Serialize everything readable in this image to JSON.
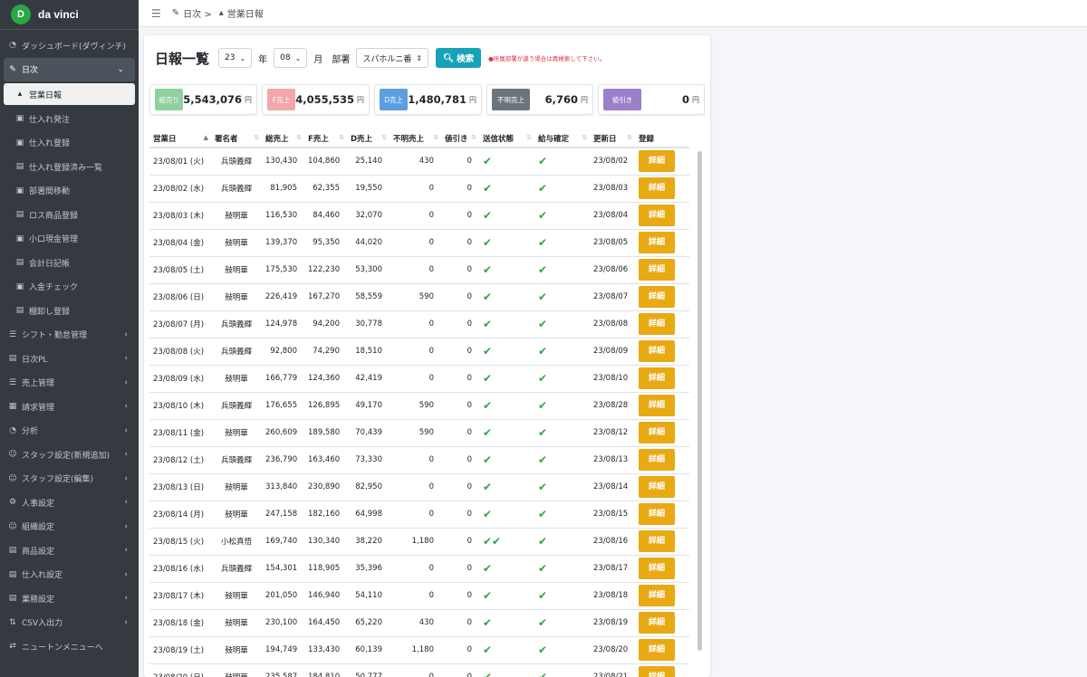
{
  "brand": {
    "logo_letter": "D",
    "name": "da vinci"
  },
  "sidebar": {
    "items": [
      {
        "icon": "◔",
        "icon_name": "dashboard-icon",
        "label": "ダッシュボード(ダヴィンチ)"
      },
      {
        "icon": "✎",
        "icon_name": "edit-icon",
        "label": "日次",
        "arrow": "⌄"
      },
      {
        "icon": "☰",
        "icon_name": "list-icon",
        "label": "シフト・勤怠管理",
        "arrow": "‹"
      },
      {
        "icon": "▤",
        "icon_name": "calendar-icon",
        "label": "日次PL",
        "arrow": "‹"
      },
      {
        "icon": "☰",
        "icon_name": "list-icon",
        "label": "売上管理",
        "arrow": "‹"
      },
      {
        "icon": "▦",
        "icon_name": "invoice-icon",
        "label": "請求管理",
        "arrow": "‹"
      },
      {
        "icon": "◔",
        "icon_name": "chart-pie-icon",
        "label": "分析",
        "arrow": "‹"
      },
      {
        "icon": "☺",
        "icon_name": "user-plus-icon",
        "label": "スタッフ設定(新規追加)",
        "arrow": "‹"
      },
      {
        "icon": "☺",
        "icon_name": "user-edit-icon",
        "label": "スタッフ設定(編集)",
        "arrow": "‹"
      },
      {
        "icon": "⚙",
        "icon_name": "gear-icon",
        "label": "人事設定",
        "arrow": "‹"
      },
      {
        "icon": "☺",
        "icon_name": "users-icon",
        "label": "組織設定",
        "arrow": "‹"
      },
      {
        "icon": "▤",
        "icon_name": "product-icon",
        "label": "商品設定",
        "arrow": "‹"
      },
      {
        "icon": "▤",
        "icon_name": "truck-icon",
        "label": "仕入れ設定",
        "arrow": "‹"
      },
      {
        "icon": "▤",
        "icon_name": "briefcase-icon",
        "label": "業務設定",
        "arrow": "‹"
      },
      {
        "icon": "⇅",
        "icon_name": "csv-icon",
        "label": "CSV入出力",
        "arrow": "‹"
      },
      {
        "icon": "⇄",
        "icon_name": "switch-icon",
        "label": "ニュートンメニューへ"
      }
    ],
    "sub_items": [
      {
        "icon": "▴",
        "icon_name": "cubes-icon",
        "label": "営業日報"
      },
      {
        "icon": "▣",
        "icon_name": "truck-icon",
        "label": "仕入れ発注"
      },
      {
        "icon": "▣",
        "icon_name": "truck-icon",
        "label": "仕入れ登録"
      },
      {
        "icon": "▤",
        "icon_name": "file-icon",
        "label": "仕入れ登録済み一覧"
      },
      {
        "icon": "▣",
        "icon_name": "transfer-icon",
        "label": "部署間移動"
      },
      {
        "icon": "▤",
        "icon_name": "trash-icon",
        "label": "ロス商品登録"
      },
      {
        "icon": "▣",
        "icon_name": "cash-icon",
        "label": "小口現金管理"
      },
      {
        "icon": "▤",
        "icon_name": "book-icon",
        "label": "会計日記帳"
      },
      {
        "icon": "▣",
        "icon_name": "deposit-icon",
        "label": "入金チェック"
      },
      {
        "icon": "▤",
        "icon_name": "inventory-icon",
        "label": "棚卸し登録"
      }
    ]
  },
  "topbar": {
    "menu_icon": "☰",
    "crumb1": "日次 >",
    "crumb2": "営業日報"
  },
  "header": {
    "title": "日報一覧",
    "year_value": "23",
    "year_label": "年",
    "month_value": "08",
    "month_label": "月",
    "dept_label": "部署",
    "dept_value": "スパホルニ番",
    "search_label": "検索",
    "warning": "●所属部署が違う場合は再検索して下さい。"
  },
  "summary": [
    {
      "badge": "総売り",
      "value": "5,543,076",
      "unit": "円",
      "color": "#8fd19e"
    },
    {
      "badge": "F売上",
      "value": "4,055,535",
      "unit": "円",
      "color": "#f1a7ac"
    },
    {
      "badge": "D売上",
      "value": "1,480,781",
      "unit": "円",
      "color": "#5b9fe0"
    },
    {
      "badge": "不明売上",
      "value": "6,760",
      "unit": "円",
      "color": "#6c757d"
    },
    {
      "badge": "値引き",
      "value": "0",
      "unit": "円",
      "color": "#9b7fc9"
    }
  ],
  "table": {
    "headers": [
      "営業日",
      "署名者",
      "総売上",
      "F売上",
      "D売上",
      "不明売上",
      "値引き",
      "送信状態",
      "給与確定",
      "更新日",
      "登録"
    ],
    "check": "✔",
    "detail_label": "詳細",
    "rows": [
      {
        "date": "23/08/01 (火)",
        "signer": "兵頭義輝",
        "total": "130,430",
        "f": "104,860",
        "d": "25,140",
        "unknown": "430",
        "discount": "0",
        "sent": "✔",
        "pay": "✔",
        "updated": "23/08/02"
      },
      {
        "date": "23/08/02 (水)",
        "signer": "兵頭義輝",
        "total": "81,905",
        "f": "62,355",
        "d": "19,550",
        "unknown": "0",
        "discount": "0",
        "sent": "✔",
        "pay": "✔",
        "updated": "23/08/03"
      },
      {
        "date": "23/08/03 (木)",
        "signer": "鼓明華",
        "total": "116,530",
        "f": "84,460",
        "d": "32,070",
        "unknown": "0",
        "discount": "0",
        "sent": "✔",
        "pay": "✔",
        "updated": "23/08/04"
      },
      {
        "date": "23/08/04 (金)",
        "signer": "鼓明華",
        "total": "139,370",
        "f": "95,350",
        "d": "44,020",
        "unknown": "0",
        "discount": "0",
        "sent": "✔",
        "pay": "✔",
        "updated": "23/08/05"
      },
      {
        "date": "23/08/05 (土)",
        "signer": "鼓明華",
        "total": "175,530",
        "f": "122,230",
        "d": "53,300",
        "unknown": "0",
        "discount": "0",
        "sent": "✔",
        "pay": "✔",
        "updated": "23/08/06"
      },
      {
        "date": "23/08/06 (日)",
        "signer": "鼓明華",
        "total": "226,419",
        "f": "167,270",
        "d": "58,559",
        "unknown": "590",
        "discount": "0",
        "sent": "✔",
        "pay": "✔",
        "updated": "23/08/07"
      },
      {
        "date": "23/08/07 (月)",
        "signer": "兵頭義輝",
        "total": "124,978",
        "f": "94,200",
        "d": "30,778",
        "unknown": "0",
        "discount": "0",
        "sent": "✔",
        "pay": "✔",
        "updated": "23/08/08"
      },
      {
        "date": "23/08/08 (火)",
        "signer": "兵頭義輝",
        "total": "92,800",
        "f": "74,290",
        "d": "18,510",
        "unknown": "0",
        "discount": "0",
        "sent": "✔",
        "pay": "✔",
        "updated": "23/08/09"
      },
      {
        "date": "23/08/09 (水)",
        "signer": "鼓明華",
        "total": "166,779",
        "f": "124,360",
        "d": "42,419",
        "unknown": "0",
        "discount": "0",
        "sent": "✔",
        "pay": "✔",
        "updated": "23/08/10"
      },
      {
        "date": "23/08/10 (木)",
        "signer": "兵頭義輝",
        "total": "176,655",
        "f": "126,895",
        "d": "49,170",
        "unknown": "590",
        "discount": "0",
        "sent": "✔",
        "pay": "✔",
        "updated": "23/08/28"
      },
      {
        "date": "23/08/11 (金)",
        "signer": "鼓明華",
        "total": "260,609",
        "f": "189,580",
        "d": "70,439",
        "unknown": "590",
        "discount": "0",
        "sent": "✔",
        "pay": "✔",
        "updated": "23/08/12"
      },
      {
        "date": "23/08/12 (土)",
        "signer": "兵頭義輝",
        "total": "236,790",
        "f": "163,460",
        "d": "73,330",
        "unknown": "0",
        "discount": "0",
        "sent": "✔",
        "pay": "✔",
        "updated": "23/08/13"
      },
      {
        "date": "23/08/13 (日)",
        "signer": "鼓明華",
        "total": "313,840",
        "f": "230,890",
        "d": "82,950",
        "unknown": "0",
        "discount": "0",
        "sent": "✔",
        "pay": "✔",
        "updated": "23/08/14"
      },
      {
        "date": "23/08/14 (月)",
        "signer": "鼓明華",
        "total": "247,158",
        "f": "182,160",
        "d": "64,998",
        "unknown": "0",
        "discount": "0",
        "sent": "✔",
        "pay": "✔",
        "updated": "23/08/15"
      },
      {
        "date": "23/08/15 (火)",
        "signer": "小松真悟",
        "total": "169,740",
        "f": "130,340",
        "d": "38,220",
        "unknown": "1,180",
        "discount": "0",
        "sent": "✔✔",
        "pay": "✔",
        "updated": "23/08/16"
      },
      {
        "date": "23/08/16 (水)",
        "signer": "兵頭義輝",
        "total": "154,301",
        "f": "118,905",
        "d": "35,396",
        "unknown": "0",
        "discount": "0",
        "sent": "✔",
        "pay": "✔",
        "updated": "23/08/17"
      },
      {
        "date": "23/08/17 (木)",
        "signer": "鼓明華",
        "total": "201,050",
        "f": "146,940",
        "d": "54,110",
        "unknown": "0",
        "discount": "0",
        "sent": "✔",
        "pay": "✔",
        "updated": "23/08/18"
      },
      {
        "date": "23/08/18 (金)",
        "signer": "鼓明華",
        "total": "230,100",
        "f": "164,450",
        "d": "65,220",
        "unknown": "430",
        "discount": "0",
        "sent": "✔",
        "pay": "✔",
        "updated": "23/08/19"
      },
      {
        "date": "23/08/19 (土)",
        "signer": "鼓明華",
        "total": "194,749",
        "f": "133,430",
        "d": "60,139",
        "unknown": "1,180",
        "discount": "0",
        "sent": "✔",
        "pay": "✔",
        "updated": "23/08/20"
      },
      {
        "date": "23/08/20 (日)",
        "signer": "鼓明華",
        "total": "235,587",
        "f": "184,810",
        "d": "50,777",
        "unknown": "0",
        "discount": "0",
        "sent": "✔",
        "pay": "✔",
        "updated": "23/08/21"
      }
    ]
  }
}
